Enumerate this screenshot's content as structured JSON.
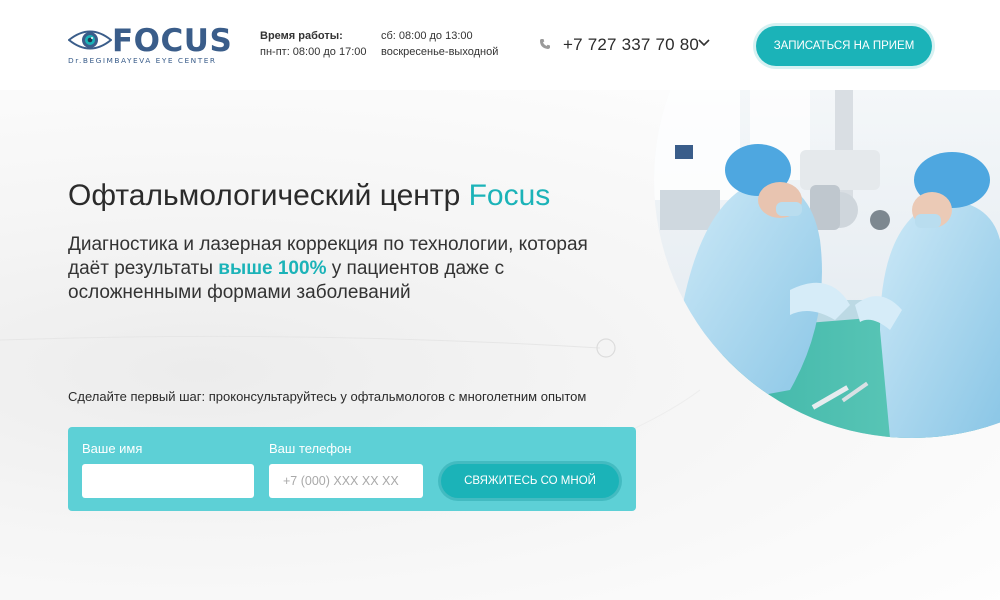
{
  "header": {
    "logo_word": "FOCUS",
    "logo_sub": "Dr.BEGIMBAYEVA EYE CENTER",
    "hours_label": "Время работы:",
    "hours_weekday": "пн-пт: 08:00 до 17:00",
    "hours_sat": "сб: 08:00 до 13:00",
    "hours_sun": "воскресенье-выходной",
    "phone": "+7 727 337 70 80",
    "cta_label": "ЗАПИСАТЬСЯ НА ПРИЕМ"
  },
  "hero": {
    "title_main": "Офтальмологический центр ",
    "title_accent": "Focus",
    "sub_part1": "Диагностика и лазерная коррекция по технологии, которая даёт результаты ",
    "sub_accent": "выше 100%",
    "sub_part2": " у пациентов даже с осложненными формами заболеваний",
    "first_step": "Сделайте первый шаг: проконсультаруйтесь у офтальмологов с многолетним опытом"
  },
  "form": {
    "name_label": "Ваше имя",
    "name_value": "",
    "phone_label": "Ваш телефон",
    "phone_placeholder": "+7 (000) XXX XX XX",
    "submit_label": "СВЯЖИТЕСЬ СО МНОЙ"
  },
  "icons": {
    "logo": "eye-icon",
    "phone": "phone-icon",
    "dropdown": "chevron-down-icon",
    "photo": "surgery-photo"
  },
  "colors": {
    "accent": "#1bb3b8",
    "form_panel": "#5dd0d6",
    "logo": "#3a5d8a"
  }
}
